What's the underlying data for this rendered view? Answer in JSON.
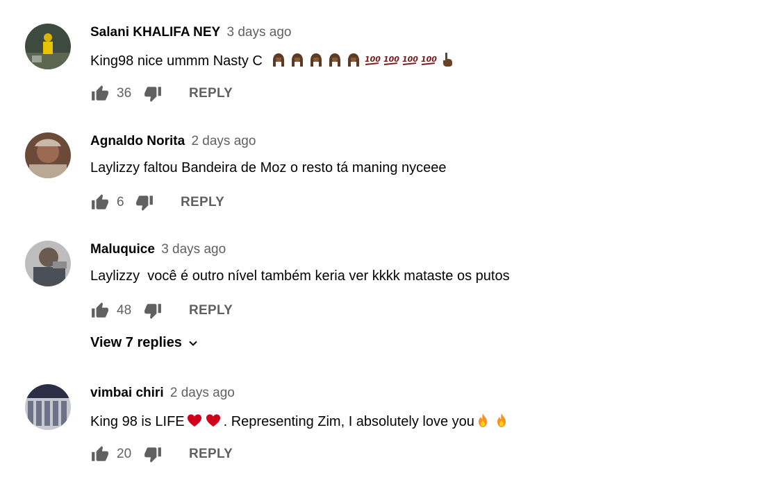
{
  "comments": [
    {
      "author": "Salani KHALIFA NEY",
      "time": "3 days ago",
      "text": "King98 nice ummm Nasty C",
      "emojis": [
        "person-hands-on-head-icon",
        "person-hands-on-head-icon",
        "person-hands-on-head-icon",
        "person-hands-on-head-icon",
        "person-hands-on-head-icon",
        "hundred-points-icon",
        "hundred-points-icon",
        "hundred-points-icon",
        "hundred-points-icon",
        "pointing-hand-icon"
      ],
      "likes": "36",
      "reply": "REPLY"
    },
    {
      "author": "Agnaldo Norita",
      "time": "2 days ago",
      "text": "Laylizzy faltou Bandeira de Moz o resto tá maning nyceee",
      "likes": "6",
      "reply": "REPLY"
    },
    {
      "author": "Maluquice",
      "time": "3 days ago",
      "text": "Laylizzy  você é outro nível também keria ver kkkk mataste os putos",
      "likes": "48",
      "reply": "REPLY",
      "view_replies": "View 7 replies"
    },
    {
      "author": "vimbai chiri",
      "time": "2 days ago",
      "text_a": "King 98 is LIFE",
      "text_b": ". Representing Zim, I absolutely love you",
      "emojis_a": [
        "red-heart-icon",
        "red-heart-icon"
      ],
      "emojis_b": [
        "fire-icon",
        "fire-icon"
      ],
      "likes": "20",
      "reply": "REPLY"
    }
  ],
  "colors": {
    "primary_text": "#030303",
    "secondary_text": "#606060",
    "icon": "#606060"
  }
}
